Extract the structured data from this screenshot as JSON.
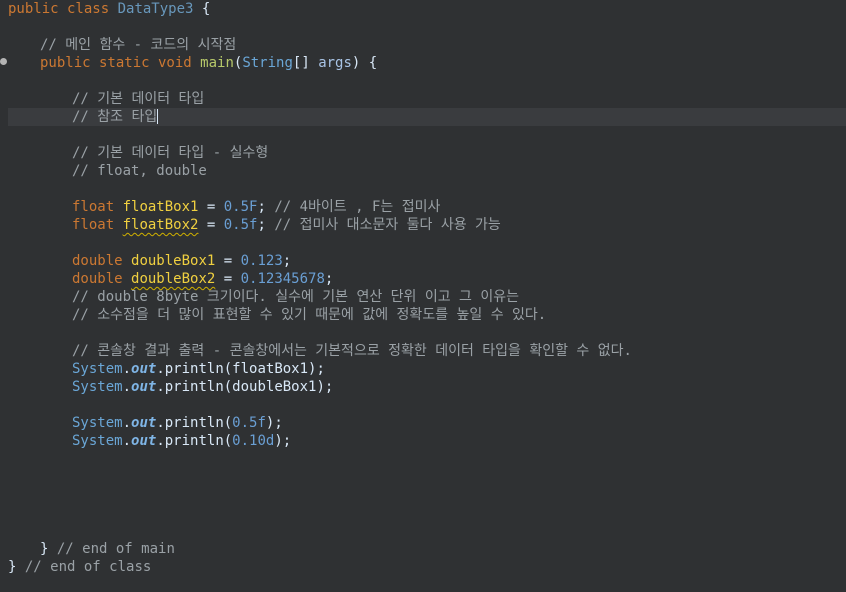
{
  "code": {
    "class_decl": {
      "kw": "public class",
      "name": "DataType3",
      "brace": " {"
    },
    "main_comment": "// 메인 함수 - 코드의 시작점",
    "main_decl": {
      "kw": "public static void",
      "name": "main",
      "open": "(",
      "type": "String",
      "arr": "[] ",
      "param": "args",
      "close": ") {"
    },
    "c1": "// 기본 데이터 타입",
    "c2": "// 참조 타입",
    "c3": "// 기본 데이터 타입 - 실수형",
    "c4": "// float, double",
    "f1": {
      "kw": "float",
      "var": "floatBox1",
      "eq": " = ",
      "val": "0.5F",
      "semi": "; ",
      "cmt": "// 4바이트 , F는 접미사"
    },
    "f2": {
      "kw": "float",
      "var": "floatBox2",
      "eq": " = ",
      "val": "0.5f",
      "semi": "; ",
      "cmt": "// 접미사 대소문자 둘다 사용 가능"
    },
    "d1": {
      "kw": "double",
      "var": "doubleBox1",
      "eq": " = ",
      "val": "0.123",
      "semi": ";"
    },
    "d2": {
      "kw": "double",
      "var": "doubleBox2",
      "eq": " = ",
      "val": "0.12345678",
      "semi": ";"
    },
    "c5": "// double 8byte 크기이다. 실수에 기본 연산 단위 이고 그 이유는",
    "c6": "// 소수점을 더 많이 표현할 수 있기 때문에 값에 정확도를 높일 수 있다.",
    "c7": "// 콘솔창 결과 출력 - 콘솔창에서는 기본적으로 정확한 데이터 타입을 확인할 수 없다.",
    "p1": {
      "sys": "System",
      "dot": ".",
      "out": "out",
      "call": ".println(",
      "arg": "floatBox1",
      "end": ");"
    },
    "p2": {
      "sys": "System",
      "dot": ".",
      "out": "out",
      "call": ".println(",
      "arg": "doubleBox1",
      "end": ");"
    },
    "p3": {
      "sys": "System",
      "dot": ".",
      "out": "out",
      "call": ".println(",
      "arg": "0.5f",
      "end": ");"
    },
    "p4": {
      "sys": "System",
      "dot": ".",
      "out": "out",
      "call": ".println(",
      "arg": "0.10d",
      "end": ");"
    },
    "end_main": {
      "brace": "}",
      "cmt": " // end of main"
    },
    "end_class": {
      "brace": "}",
      "cmt": " // end of class"
    }
  }
}
